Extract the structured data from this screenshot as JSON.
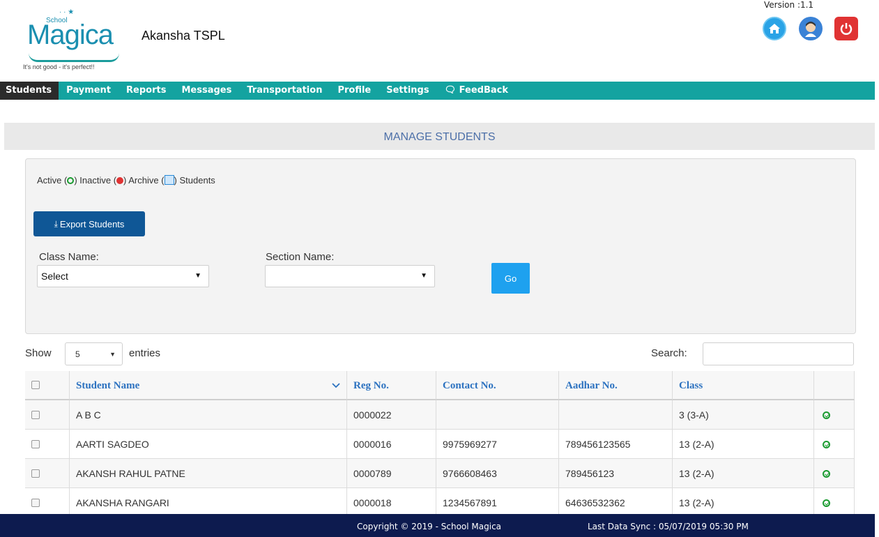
{
  "header": {
    "logo": {
      "small_text": "School",
      "brand": "Magica",
      "tagline": "It's not good - it's perfect!!"
    },
    "school_name": "Akansha TSPL",
    "version": "Version :1.1"
  },
  "nav": {
    "items": [
      "Students",
      "Payment",
      "Reports",
      "Messages",
      "Transportation",
      "Profile",
      "Settings",
      "FeedBack"
    ],
    "active": "Students"
  },
  "page_title": "MANAGE STUDENTS",
  "legend": {
    "active": "Active (",
    "inactive": ") Inactive (",
    "archive": ") Archive (",
    "students": ") Students"
  },
  "export_button": "Export Students",
  "filters": {
    "class_label": "Class Name:",
    "class_value": "Select",
    "section_label": "Section Name:",
    "section_value": "",
    "go_label": "Go"
  },
  "table_controls": {
    "show": "Show",
    "entries_value": "5",
    "entries": "entries",
    "search": "Search:",
    "search_value": ""
  },
  "table": {
    "columns": [
      "Student Name",
      "Reg No.",
      "Contact No.",
      "Aadhar No.",
      "Class"
    ],
    "rows": [
      {
        "name": "A B C",
        "reg": "0000022",
        "contact": "",
        "aadhar": "",
        "class": "3 (3-A)"
      },
      {
        "name": "AARTI SAGDEO",
        "reg": "0000016",
        "contact": "9975969277",
        "aadhar": "789456123565",
        "class": "13 (2-A)"
      },
      {
        "name": "AKANSH RAHUL PATNE",
        "reg": "0000789",
        "contact": "9766608463",
        "aadhar": "789456123",
        "class": "13 (2-A)"
      },
      {
        "name": "AKANSHA RANGARI",
        "reg": "0000018",
        "contact": "1234567891",
        "aadhar": "64636532362",
        "class": "13 (2-A)"
      }
    ]
  },
  "footer": {
    "copyright": "Copyright © 2019 - School Magica",
    "sync": "Last Data Sync : 05/07/2019 05:30 PM"
  },
  "colors": {
    "nav": "#14a3a0",
    "footer": "#0d1b4f",
    "export": "#0f5796",
    "go": "#1ea1ef",
    "active": "#1a9b30"
  }
}
